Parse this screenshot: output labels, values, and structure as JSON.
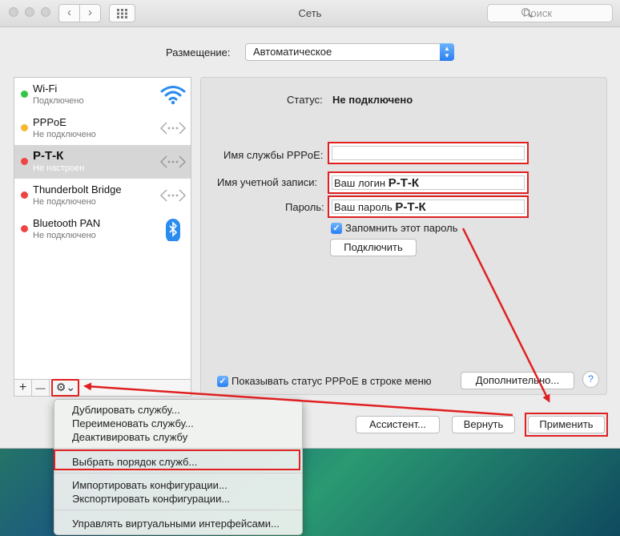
{
  "window": {
    "title": "Сеть"
  },
  "search": {
    "placeholder": "Поиск"
  },
  "location": {
    "label": "Размещение:",
    "value": "Автоматическое"
  },
  "services": [
    {
      "name": "Wi-Fi",
      "status": "Подключено",
      "dot_color": "#34c548",
      "icon": "wifi-icon"
    },
    {
      "name": "PPPoE",
      "status": "Не подключено",
      "dot_color": "#f5b82e",
      "icon": "network-arrows-icon"
    },
    {
      "name": "Р-Т-К",
      "status": "Не настроен",
      "dot_color": "#ee4444",
      "icon": "network-arrows-icon"
    },
    {
      "name": "Thunderbolt Bridge",
      "status": "Не подключено",
      "dot_color": "#ee4444",
      "icon": "network-arrows-icon"
    },
    {
      "name": "Bluetooth PAN",
      "status": "Не подключено",
      "dot_color": "#ee4444",
      "icon": "bluetooth-icon"
    }
  ],
  "sidebar_buttons": {
    "add": "+",
    "remove": "—",
    "gear": "⚙⌄"
  },
  "panel": {
    "status_label": "Статус:",
    "status_value": "Не подключено",
    "service_name_label": "Имя службы PPPoE:",
    "service_name_value": "",
    "account_label": "Имя учетной записи:",
    "account_prefix": "Ваш логин ",
    "account_bold": "Р-Т-К",
    "password_label": "Пароль:",
    "password_prefix": "Ваш пароль ",
    "password_bold": "Р-Т-К",
    "remember_label": "Запомнить этот пароль",
    "connect_button": "Подключить",
    "show_status_label": "Показывать статус PPPoE в строке меню",
    "advanced_button": "Дополнительно...",
    "help_button": "?"
  },
  "footer": {
    "assistant_button": "Ассистент...",
    "revert_button": "Вернуть",
    "apply_button": "Применить"
  },
  "context_menu": {
    "items": [
      "Дублировать службу...",
      "Переименовать службу...",
      "Деактивировать службу",
      "Выбрать порядок служб...",
      "Импортировать конфигурации...",
      "Экспортировать конфигурации...",
      "Управлять виртуальными интерфейсами..."
    ]
  },
  "colors": {
    "accent": "#2a7ff3",
    "annotation": "#e02020"
  }
}
